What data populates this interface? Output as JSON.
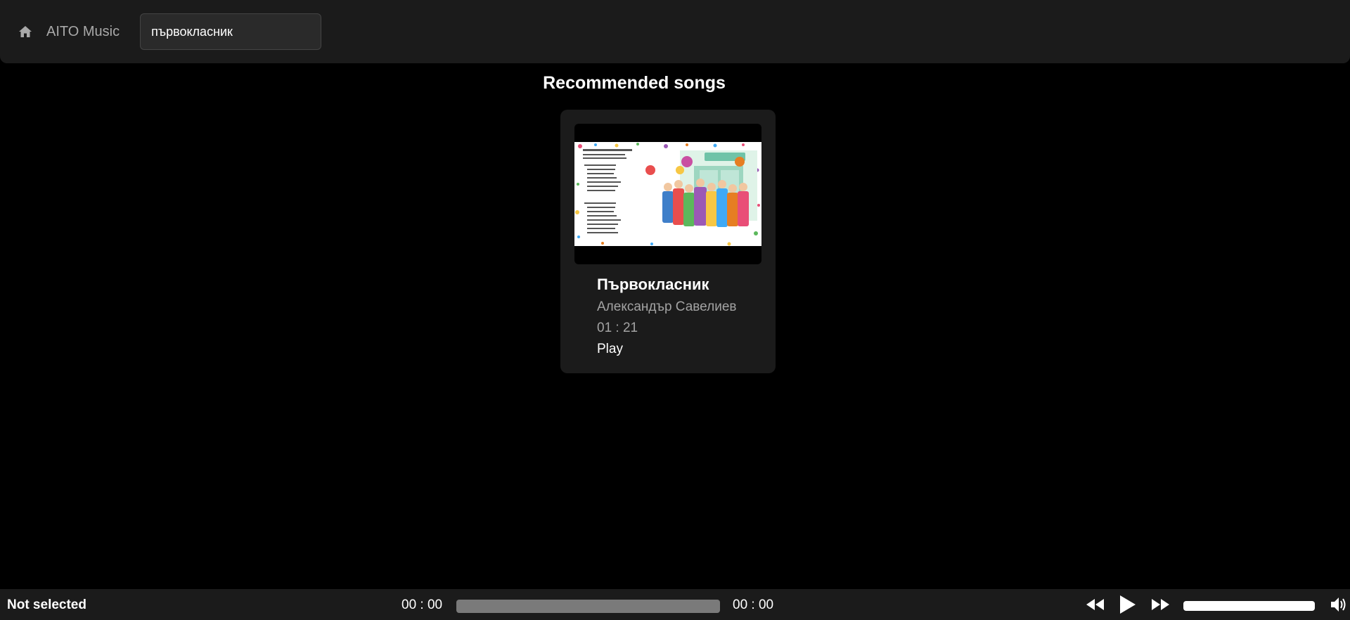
{
  "header": {
    "brand": "AITO Music",
    "search_value": "първокласник",
    "home_icon": "home-icon"
  },
  "main": {
    "section_title": "Recommended songs",
    "songs": [
      {
        "title": "Първокласник",
        "artist": "Александър Савелиев",
        "duration": "01 : 21",
        "play_label": "Play"
      }
    ]
  },
  "player": {
    "now_playing": "Not selected",
    "current_time": "00 : 00",
    "total_time": "00 : 00",
    "progress": 0,
    "volume": 1.0,
    "icons": [
      "rewind-icon",
      "play-icon",
      "fast-forward-icon",
      "volume-icon"
    ]
  },
  "colors": {
    "background": "#000000",
    "surface": "#1b1b1b",
    "muted_text": "#a3a3a3"
  }
}
